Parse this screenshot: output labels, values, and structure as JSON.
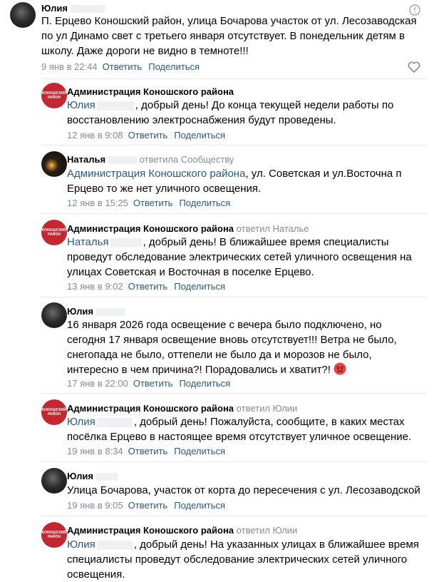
{
  "comment": {
    "author": "Юлия",
    "text": "П. Ерцево Коношский район, улица Бочарова участок от ул. Лесозаводская по ул Динамо свет с третьего января отсутствует. В понедельник детям в школу. Даже дороги не видно в темноте!!!",
    "time": "9 янв в 22:44",
    "reply_label": "Ответить",
    "share_label": "Поделиться"
  },
  "replies": [
    {
      "author": "Администрация Коношского района",
      "replied_to": "",
      "mention": "Юлия",
      "text": ", добрый день! До конца текущей недели работы по восстановлению электроснабжения будут проведены.",
      "time": "12 янв в 9:08",
      "reply_label": "Ответить",
      "share_label": "Поделиться"
    },
    {
      "author": "Наталья",
      "replied_to": "ответила Сообществу",
      "mention": "Администрация Коношского района",
      "text": ", ул. Советская и ул.Восточна п Ерцево то же нет уличного освещения.",
      "time": "12 янв в 15:25",
      "reply_label": "Ответить",
      "share_label": "Поделиться"
    },
    {
      "author": "Администрация Коношского района",
      "replied_to": "ответил Наталье",
      "mention": "Наталья",
      "text": ", добрый день! В ближайшее время специалисты проведут обследование электрических сетей уличного освещения на улицах Советская и Восточная в поселке Ерцево.",
      "time": "13 янв в 9:02",
      "reply_label": "Ответить",
      "share_label": "Поделиться"
    },
    {
      "author": "Юлия",
      "replied_to": "",
      "mention": "",
      "text": "16 января 2026 года освещение с вечера было подключено, но сегодня 17 января освещение вновь отсутствует!!! Ветра не было, снегопада не было, оттепели не было да и морозов не было, интересно в чем причина?! Порадовались и хватит?!",
      "time": "17 янв в 22:00",
      "reply_label": "Ответить",
      "share_label": "Поделиться"
    },
    {
      "author": "Администрация Коношского района",
      "replied_to": "ответил Юлии",
      "mention": "Юлия",
      "text": ", добрый день! Пожалуйста, сообщите, в каких местах посёлка Ерцево в настоящее время отсутствует уличное освещение.",
      "time": "19 янв в 8:34",
      "reply_label": "Ответить",
      "share_label": "Поделиться"
    },
    {
      "author": "Юлия",
      "replied_to": "",
      "mention": "",
      "text": "Улица Бочарова, участок от корта до пересечения с ул. Лесозаводской",
      "time": "19 янв в 9:05",
      "reply_label": "Ответить",
      "share_label": "Поделиться"
    },
    {
      "author": "Администрация Коношского района",
      "replied_to": "ответил Юлии",
      "mention": "Юлия",
      "text": ", добрый день! На указанных улицах в ближайшее время специалисты проведут обследование электрических сетей уличного освещения.",
      "time": "",
      "reply_label": "",
      "share_label": ""
    }
  ],
  "admin_avatar_text": "КОНОШСКИЙ РАЙОН",
  "colors": {
    "link": "#2a5885",
    "meta": "#818c99",
    "admin_brand": "#c4272f"
  },
  "icons": {
    "more": "info-circle-icon",
    "like": "heart-outline-icon",
    "emoji": "angry-face-emoji-icon"
  }
}
